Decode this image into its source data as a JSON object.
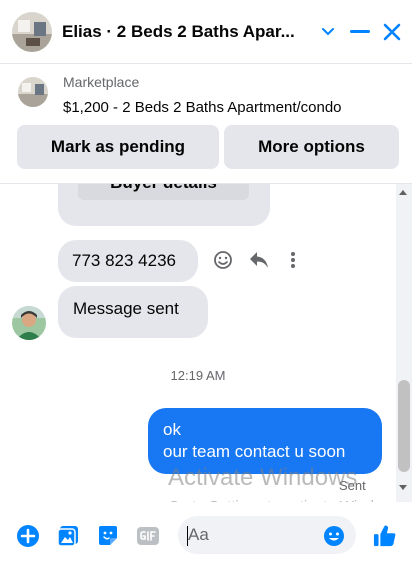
{
  "header": {
    "title": "Elias · 2 Beds 2 Baths Apar...",
    "colors": {
      "accent": "#0084ff"
    }
  },
  "marketplace": {
    "label": "Marketplace",
    "listing": "$1,200 - 2 Beds 2 Baths Apartment/condo",
    "mark_pending_label": "Mark as pending",
    "more_options_label": "More options"
  },
  "chat": {
    "buyer_details_label": "Buyer details",
    "phone_message": "773 823 4236",
    "system_message": "Message sent",
    "timestamp": "12:19 AM",
    "outgoing_lines": [
      "ok",
      "our team contact u soon"
    ],
    "status": "Sent",
    "colors": {
      "outgoing_bubble": "#1877f2",
      "incoming_bubble": "#e4e6eb"
    }
  },
  "watermark": {
    "title": "Activate Windows",
    "subtitle": "Go to Settings to activate Windows."
  },
  "composer": {
    "placeholder": "Aa"
  }
}
